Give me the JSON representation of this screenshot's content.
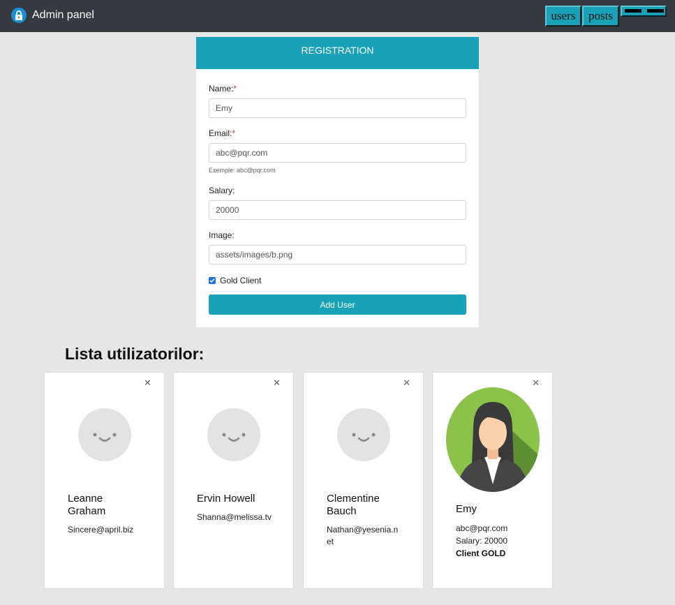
{
  "app": {
    "title": "Admin panel",
    "icon": "lock-icon"
  },
  "nav": {
    "users_label": "users",
    "posts_label": "posts",
    "toggle_icon": "menu-toggle-icon"
  },
  "form": {
    "header": "REGISTRATION",
    "name_label": "Name:",
    "name_value": "Emy",
    "email_label": "Email:",
    "email_value": "abc@pqr.com",
    "email_help": "Exemple: abc@pqr.com",
    "salary_label": "Salary:",
    "salary_value": "20000",
    "image_label": "Image:",
    "image_value": "assets/images/b.png",
    "gold_label": "Gold Client",
    "gold_checked": true,
    "submit_label": "Add User",
    "required_marker": "*"
  },
  "list": {
    "title": "Lista utilizatorilor:",
    "close_symbol": "✕",
    "users": [
      {
        "name": "Leanne Graham",
        "email": "Sincere@april.biz"
      },
      {
        "name": "Ervin Howell",
        "email": "Shanna@melissa.tv"
      },
      {
        "name": "Clementine Bauch",
        "email": "Nathan@yesenia.net"
      },
      {
        "name": "Emy",
        "email": "abc@pqr.com",
        "salary": "Salary: 20000",
        "gold": "Client GOLD"
      }
    ]
  },
  "colors": {
    "accent": "#17a2b8",
    "topbar": "#343a40",
    "background": "#e5e6e5"
  }
}
